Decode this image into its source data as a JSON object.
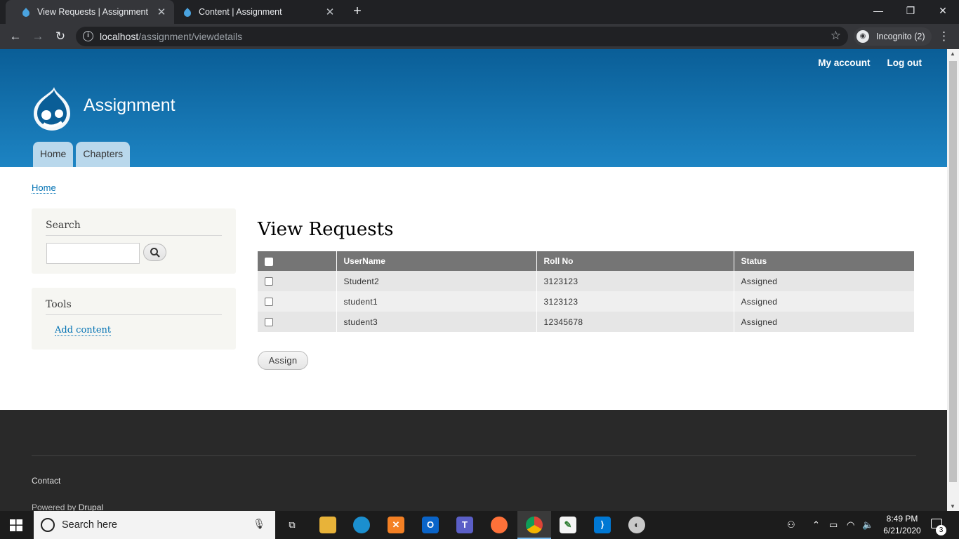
{
  "browser": {
    "tabs": [
      {
        "title": "View Requests | Assignment",
        "active": true
      },
      {
        "title": "Content | Assignment",
        "active": false
      }
    ],
    "new_tab": "+",
    "url_host": "localhost",
    "url_path": "/assignment/viewdetails",
    "incognito_label": "Incognito (2)"
  },
  "header": {
    "site_name": "Assignment",
    "secondary_menu": [
      "My account",
      "Log out"
    ],
    "main_menu": [
      "Home",
      "Chapters"
    ]
  },
  "breadcrumb": "Home",
  "sidebar": {
    "search_block": {
      "title": "Search",
      "input_value": ""
    },
    "tools_block": {
      "title": "Tools",
      "link": "Add content"
    }
  },
  "main": {
    "title": "View Requests",
    "table": {
      "headers": [
        "UserName",
        "Roll No",
        "Status"
      ],
      "rows": [
        {
          "username": "Student2",
          "roll": "3123123",
          "status": "Assigned"
        },
        {
          "username": "student1",
          "roll": "3123123",
          "status": "Assigned"
        },
        {
          "username": "student3",
          "roll": "12345678",
          "status": "Assigned"
        }
      ]
    },
    "assign_button": "Assign"
  },
  "footer": {
    "contact": "Contact",
    "powered_prefix": "Powered by ",
    "powered_name": "Drupal"
  },
  "taskbar": {
    "search_placeholder": "Search here",
    "time": "8:49 PM",
    "date": "6/21/2020",
    "notification_count": "3"
  },
  "colors": {
    "header_top": "#0a5e97",
    "header_bottom": "#1d84c3",
    "link": "#0071b3",
    "table_header": "#757575",
    "footer": "#292929"
  }
}
